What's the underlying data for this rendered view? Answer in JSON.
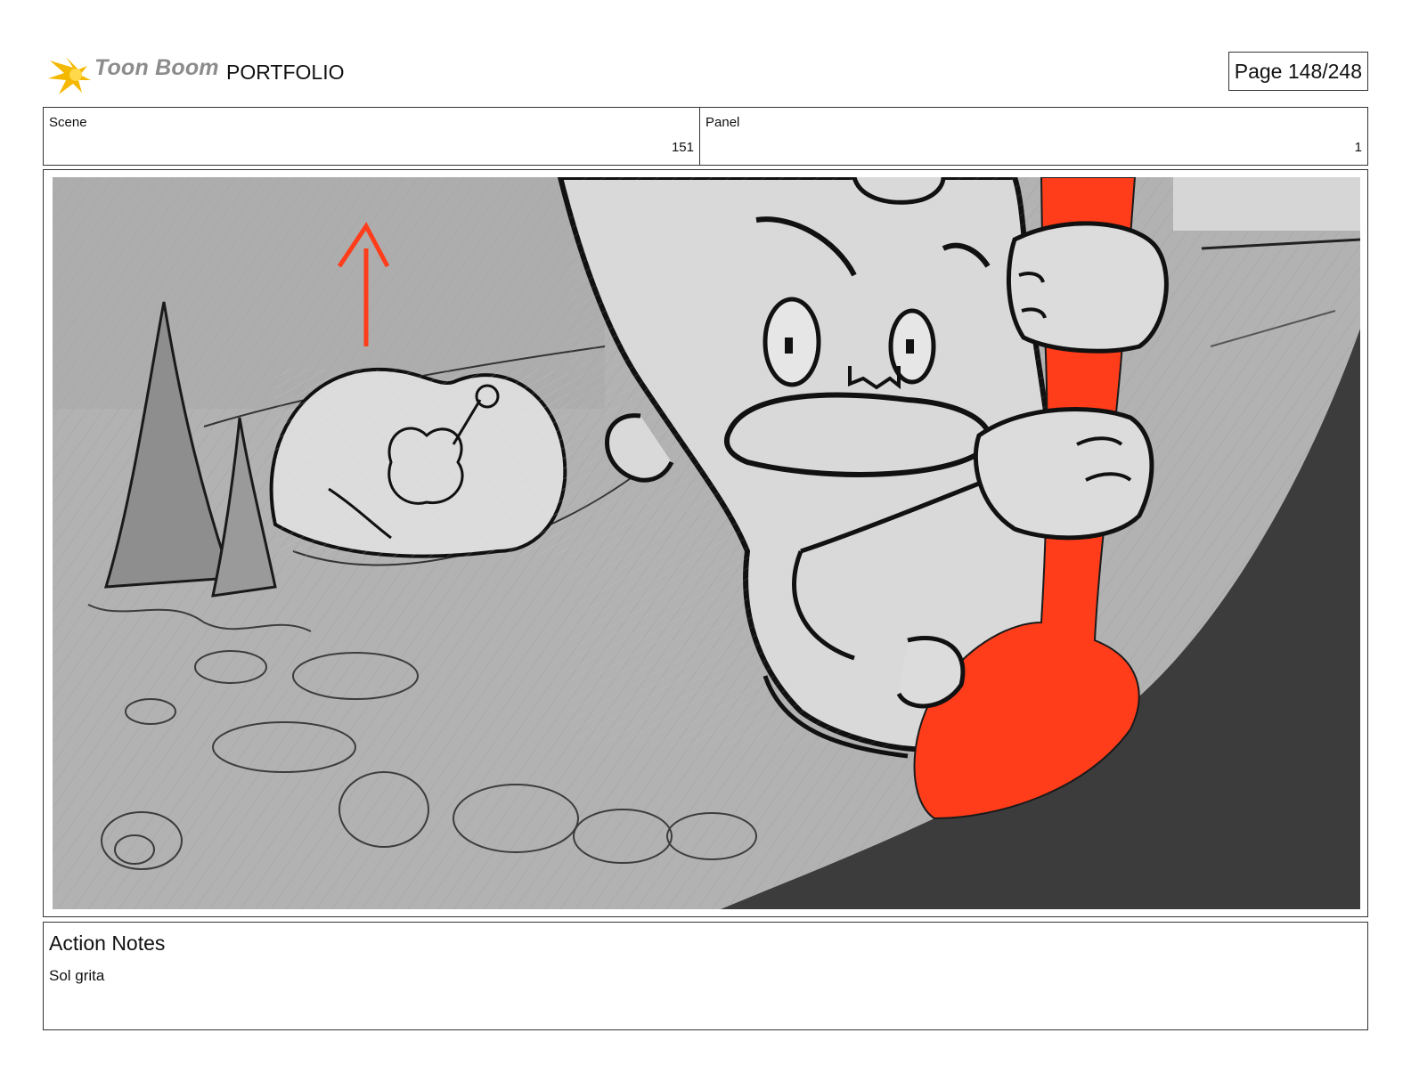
{
  "header": {
    "brand": "Toon Boom",
    "app_name": "PORTFOLIO",
    "page_label": "Page 148/248"
  },
  "info": {
    "scene_label": "Scene",
    "scene_value": "151",
    "panel_label": "Panel",
    "panel_value": "1"
  },
  "notes": {
    "title": "Action Notes",
    "body": "Sol grita"
  },
  "colors": {
    "accent_red": "#ff3d1a",
    "logo_yellow": "#f5b800",
    "sketch_gray": "#b9b9b9",
    "dark_gray": "#3c3c3c"
  }
}
